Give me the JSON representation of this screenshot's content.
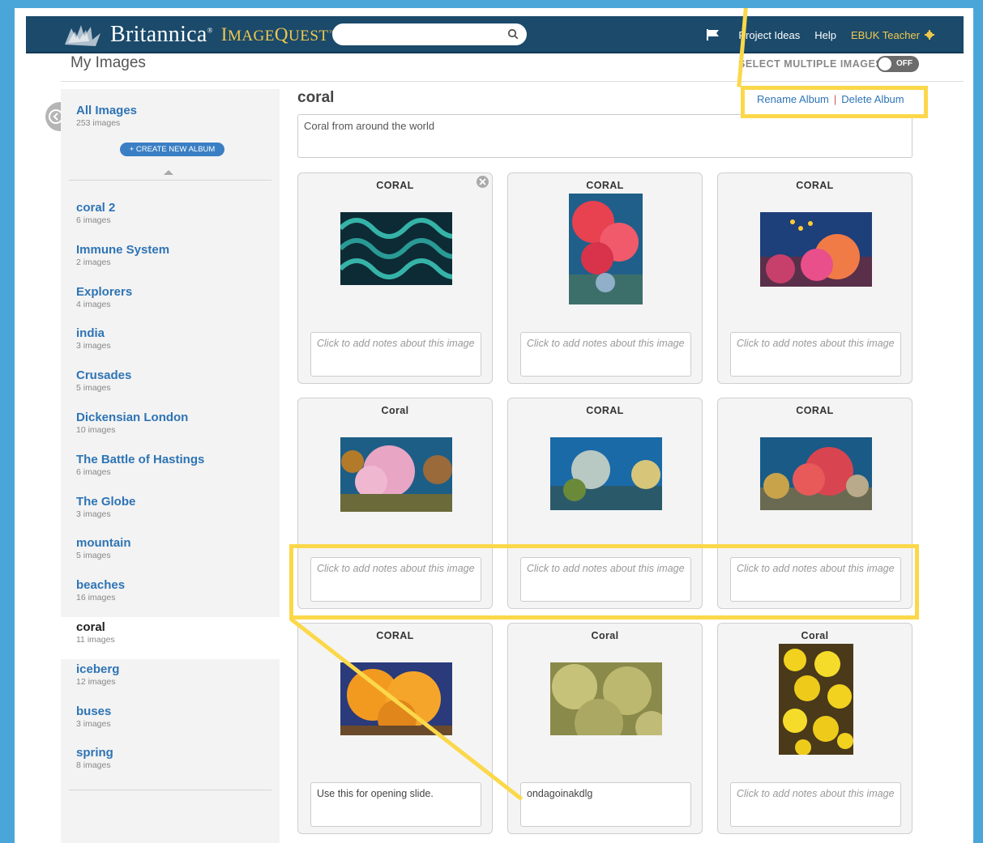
{
  "brand": {
    "name": "Britannica",
    "reg": "®",
    "product_prefix": "I",
    "product_mid": "MAGE",
    "product_q": "Q",
    "product_suffix": "UEST",
    "tm": "™"
  },
  "nav": {
    "project_ideas": "Project Ideas",
    "help": "Help",
    "user": "EBUK Teacher"
  },
  "search": {
    "placeholder": ""
  },
  "page_title": "My Images",
  "select_multiple": {
    "label": "SELECT MULTIPLE IMAGES",
    "state": "OFF"
  },
  "sidebar": {
    "all_images": {
      "name": "All Images",
      "count": "253 images"
    },
    "create_label": "+ CREATE NEW ALBUM",
    "albums": [
      {
        "name": "coral 2",
        "count": "6 images"
      },
      {
        "name": "Immune System",
        "count": "2 images"
      },
      {
        "name": "Explorers",
        "count": "4 images"
      },
      {
        "name": "india",
        "count": "3 images"
      },
      {
        "name": "Crusades",
        "count": "5 images"
      },
      {
        "name": "Dickensian London",
        "count": "10 images"
      },
      {
        "name": "The Battle of Hastings",
        "count": "6 images"
      },
      {
        "name": "The Globe",
        "count": "3 images"
      },
      {
        "name": "mountain",
        "count": "5 images"
      },
      {
        "name": "beaches",
        "count": "16 images"
      },
      {
        "name": "coral",
        "count": "11 images"
      },
      {
        "name": "iceberg",
        "count": "12 images"
      },
      {
        "name": "buses",
        "count": "3 images"
      },
      {
        "name": "spring",
        "count": "8 images"
      }
    ]
  },
  "album": {
    "title": "coral",
    "rename": "Rename Album",
    "separator": "|",
    "delete": "Delete Album",
    "description": "Coral from around the world"
  },
  "cards": [
    {
      "title": "CORAL",
      "note": "Click to add notes about this image",
      "note_filled": false,
      "image": "brain coral"
    },
    {
      "title": "CORAL",
      "note": "Click to add notes about this image",
      "note_filled": false,
      "image": "red soft coral"
    },
    {
      "title": "CORAL",
      "note": "Click to add notes about this image",
      "note_filled": false,
      "image": "reef with fish"
    },
    {
      "title": "Coral",
      "note": "Click to add notes about this image",
      "note_filled": false,
      "image": "pink soft coral"
    },
    {
      "title": "CORAL",
      "note": "Click to add notes about this image",
      "note_filled": false,
      "image": "blue reef"
    },
    {
      "title": "CORAL",
      "note": "Click to add notes about this image",
      "note_filled": false,
      "image": "red fan coral"
    },
    {
      "title": "CORAL",
      "note": "Use this for opening slide.",
      "note_filled": true,
      "image": "orange sponge"
    },
    {
      "title": "Coral",
      "note": "ondagoinakdlg",
      "note_filled": true,
      "image": "yellow brain coral"
    },
    {
      "title": "Coral",
      "note": "Click to add notes about this image",
      "note_filled": false,
      "image": "yellow polyps"
    }
  ],
  "colors": {
    "highlight": "#fbd84a",
    "topbar": "#1b4a6b",
    "link": "#2e74b5",
    "accent_gold": "#f2c94c",
    "page_bg": "#4aa6d9"
  }
}
